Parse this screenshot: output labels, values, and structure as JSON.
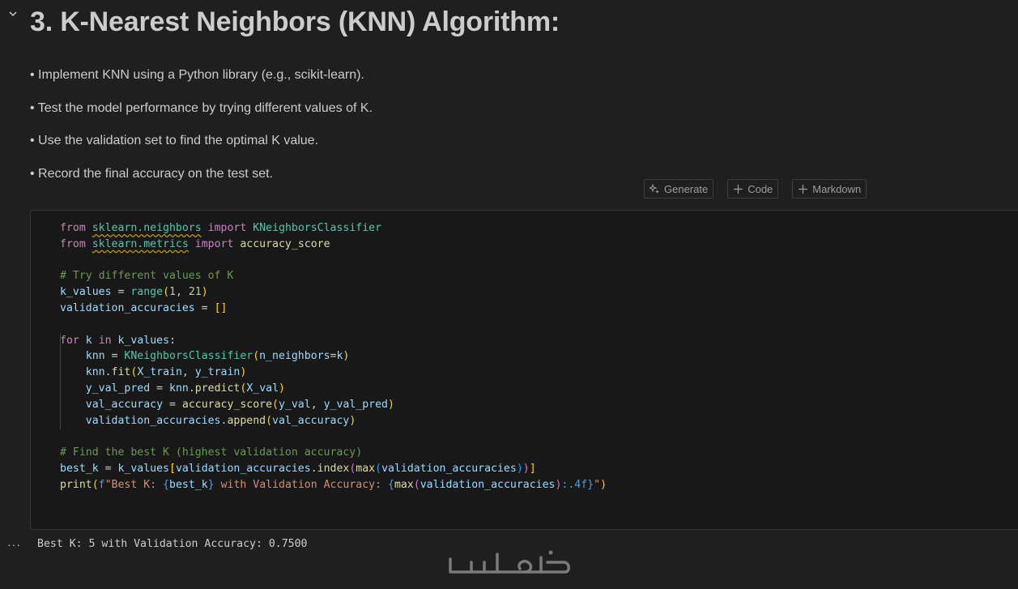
{
  "heading": "3. K-Nearest Neighbors (KNN) Algorithm:",
  "bullets": [
    "• Implement KNN using a Python library (e.g., scikit-learn).",
    "• Test the model performance by trying different values of K.",
    "• Use the validation set to find the optimal K value.",
    "• Record the final accuracy on the test set."
  ],
  "toolbar": {
    "generate_label": "Generate",
    "code_label": "Code",
    "markdown_label": "Markdown"
  },
  "code": {
    "lines": [
      "from sklearn.neighbors import KNeighborsClassifier",
      "from sklearn.metrics import accuracy_score",
      "",
      "# Try different values of K",
      "k_values = range(1, 21)",
      "validation_accuracies = []",
      "",
      "for k in k_values:",
      "    knn = KNeighborsClassifier(n_neighbors=k)",
      "    knn.fit(X_train, y_train)",
      "    y_val_pred = knn.predict(X_val)",
      "    val_accuracy = accuracy_score(y_val, y_val_pred)",
      "    validation_accuracies.append(val_accuracy)",
      "",
      "# Find the best K (highest validation accuracy)",
      "best_k = k_values[validation_accuracies.index(max(validation_accuracies))]",
      "print(f\"Best K: {best_k} with Validation Accuracy: {max(validation_accuracies):.4f}\")"
    ]
  },
  "output": {
    "more_label": "···",
    "text": "Best K: 5 with Validation Accuracy: 0.7500"
  },
  "icons": {
    "collapse": "chevron-down-icon",
    "generate": "sparkle-icon",
    "code": "plus-icon",
    "markdown": "plus-icon",
    "watermark": "khamsat-logo"
  },
  "colors": {
    "background": "#1f1f1f",
    "cell_background": "#181818",
    "keyword": "#c586c0",
    "builtin": "#569cd6",
    "type": "#4ec9b0",
    "function": "#dcdcaa",
    "variable": "#9cdcfe",
    "number": "#b5cea8",
    "string": "#ce9178",
    "comment": "#6a9955"
  }
}
